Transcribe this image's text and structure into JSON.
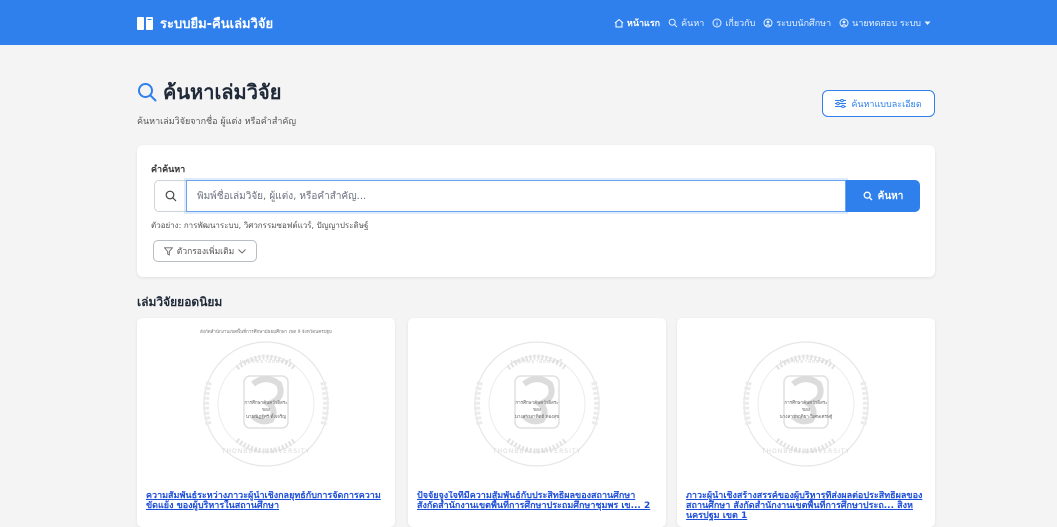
{
  "navbar": {
    "brand": "ระบบยืม-คืนเล่มวิจัย",
    "links": [
      {
        "label": "หน้าแรก",
        "icon": "home-icon"
      },
      {
        "label": "ค้นหา",
        "icon": "search-icon"
      },
      {
        "label": "เกี่ยวกับ",
        "icon": "info-icon"
      },
      {
        "label": "ระบบนักศึกษา",
        "icon": "user-circle-icon"
      },
      {
        "label": "นายทดสอบ ระบบ",
        "icon": "user-circle-icon"
      }
    ]
  },
  "page": {
    "title": "ค้นหาเล่มวิจัย",
    "subtitle": "ค้นหาเล่มวิจัยจากชื่อ ผู้แต่ง หรือคำสำคัญ",
    "advanced_button": "ค้นหาแบบละเอียด"
  },
  "search": {
    "label": "คำค้นหา",
    "placeholder": "พิมพ์ชื่อเล่มวิจัย, ผู้แต่ง, หรือคำสำคัญ...",
    "value": "",
    "submit_label": "ค้นหา",
    "example": "ตัวอย่าง: การพัฒนาระบบ, วิศวกรรมซอฟต์แวร์, ปัญญาประดิษฐ์",
    "filter_button": "ตัวกรองเพิ่มเติม"
  },
  "popular": {
    "heading": "เล่มวิจัยยอดนิยม",
    "books": [
      {
        "title": "ความสัมพันธ์ระหว่างภาวะผู้นำเชิงกลยุทธ์กับการจัดการความขัดแย้ง ของผู้บริหารในสถานศึกษา",
        "cover_header": "สังกัดสำนักงานเขตพื้นที่การศึกษามัธยมศึกษา เขต 9 จังหวัดนครปฐม",
        "cover_lines": [
          "การศึกษาค้นคว้าอิสระ",
          "ของ",
          "นายณัฏฐ์ศรี ตั้งเจริญ"
        ],
        "watermark_top": "มหาวิทยาลัยธนบุรี",
        "watermark_bottom": "THONBURI UNIVERSITY"
      },
      {
        "title": "ปัจจัยจูงใจที่มีความสัมพันธ์กับประสิทธิผลของสถานศึกษา สังกัดสำนักงานเขตพื้นที่การศึกษาประถมศึกษาชุมพร เข... 2",
        "cover_header": "",
        "cover_lines": [
          "การศึกษาค้นคว้าอิสระ",
          "ของ",
          "นางสาวอาทิตย์ ทองสุข"
        ],
        "watermark_top": "มหาวิทยาลัยธนบุรี",
        "watermark_bottom": "THONBURI UNIVERSITY"
      },
      {
        "title": "ภาวะผู้นำเชิงสร้างสรรค์ของผู้บริหารที่ส่งผลต่อประสิทธิผลของสถานศึกษา สังกัดสำนักงานเขตพื้นที่การศึกษาประถ... สิงหนครปฐม เขต 1",
        "cover_header": "",
        "cover_lines": [
          "การศึกษาค้นคว้าอิสระ",
          "ของ",
          "นางสาวกฤติยา วิเศษเศรษฐ์"
        ],
        "watermark_top": "มหาวิทยาลัยธนบุรี",
        "watermark_bottom": "THONBURI UNIVERSITY"
      }
    ]
  },
  "colors": {
    "primary": "#2f80ed",
    "background": "#f4f4f5",
    "link": "#1d4ed8"
  }
}
